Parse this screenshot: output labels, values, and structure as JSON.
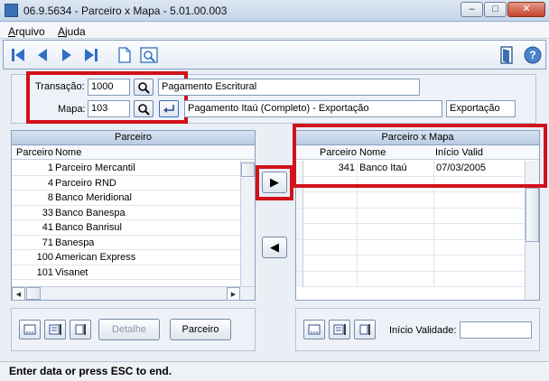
{
  "window": {
    "title": "06.9.5634 - Parceiro x Mapa - 5.01.00.003",
    "minimize": "–",
    "maximize": "□",
    "close": "✕"
  },
  "menu": {
    "arquivo_first": "A",
    "arquivo_rest": "rquivo",
    "ajuda_first": "A",
    "ajuda_rest": "juda"
  },
  "toolbar": {
    "icons": [
      "first-record-icon",
      "previous-record-icon",
      "next-record-icon",
      "last-record-icon",
      "new-document-icon",
      "preview-icon",
      "exit-door-icon",
      "help-icon"
    ]
  },
  "header": {
    "transacao_label": "Transação:",
    "transacao_value": "1000",
    "transacao_desc": "Pagamento Escritural",
    "mapa_label": "Mapa:",
    "mapa_value": "103",
    "mapa_desc": "Pagamento Itaú (Completo) - Exportação",
    "mapa_tipo": "Exportação"
  },
  "parceiro_grid": {
    "title": "Parceiro",
    "col_parceiro": "Parceiro",
    "col_nome": "Nome",
    "rows": [
      {
        "code": "1",
        "name": "Parceiro Mercantil"
      },
      {
        "code": "4",
        "name": "Parceiro RND"
      },
      {
        "code": "8",
        "name": "Banco Meridional"
      },
      {
        "code": "33",
        "name": "Banco Banespa"
      },
      {
        "code": "41",
        "name": "Banco Banrisul"
      },
      {
        "code": "71",
        "name": "Banespa"
      },
      {
        "code": "100",
        "name": "American Express"
      },
      {
        "code": "101",
        "name": "Visanet"
      }
    ]
  },
  "mapa_grid": {
    "title": "Parceiro x Mapa",
    "col_parceiro": "Parceiro",
    "col_nome": "Nome",
    "col_inicio": "Início Valid",
    "rows": [
      {
        "code": "341",
        "name": "Banco Itaú",
        "inicio": "07/03/2005"
      }
    ]
  },
  "buttons": {
    "detalhe": "Detalhe",
    "parceiro": "Parceiro",
    "add_arrow": "▶",
    "remove_arrow": "◀"
  },
  "bottom_right": {
    "inicio_validade_label": "Início Validade:",
    "inicio_validade_value": ""
  },
  "status": {
    "text": "Enter data or press ESC to end."
  },
  "colors": {
    "highlight": "#d1111b",
    "accent": "#3a6fb5"
  }
}
